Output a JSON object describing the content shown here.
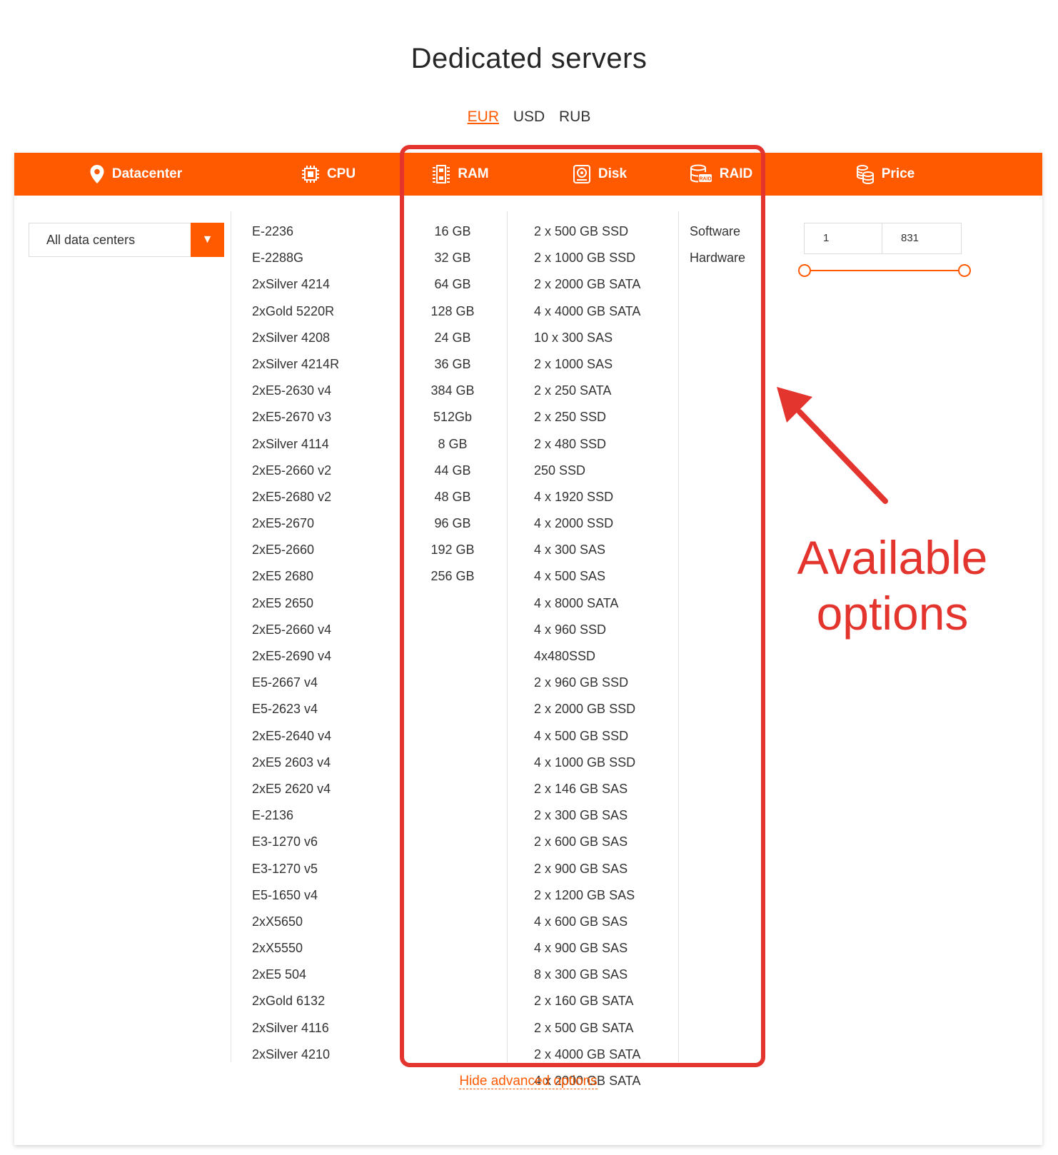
{
  "title": "Dedicated servers",
  "currencies": [
    "EUR",
    "USD",
    "RUB"
  ],
  "active_currency": "EUR",
  "header": {
    "datacenter": "Datacenter",
    "cpu": "CPU",
    "ram": "RAM",
    "disk": "Disk",
    "raid": "RAID",
    "price": "Price"
  },
  "datacenter_select": {
    "value": "All data centers"
  },
  "cpu_options": [
    "E-2236",
    "E-2288G",
    "2xSilver 4214",
    "2xGold 5220R",
    "2xSilver 4208",
    "2xSilver 4214R",
    "2xE5-2630 v4",
    "2xE5-2670 v3",
    "2xSilver 4114",
    "2xE5-2660 v2",
    "2xE5-2680 v2",
    "2xE5-2670",
    "2xE5-2660",
    "2xE5 2680",
    "2xE5 2650",
    "2xE5-2660 v4",
    "2xE5-2690 v4",
    "E5-2667 v4",
    "E5-2623 v4",
    "2xE5-2640 v4",
    "2xE5 2603 v4",
    "2xE5 2620 v4",
    "E-2136",
    "E3-1270 v6",
    "E3-1270 v5",
    "E5-1650 v4",
    "2xX5650",
    "2xX5550",
    "2xE5 504",
    "2xGold 6132",
    "2xSilver 4116",
    "2xSilver 4210"
  ],
  "ram_options": [
    "16 GB",
    "32 GB",
    "64 GB",
    "128 GB",
    "24 GB",
    "36 GB",
    "384 GB",
    "512Gb",
    "8 GB",
    "44 GB",
    "48 GB",
    "96 GB",
    "192 GB",
    "256 GB"
  ],
  "disk_options": [
    "2 x 500 GB SSD",
    "2 x 1000 GB SSD",
    "2 x 2000 GB SATA",
    "4 x 4000 GB SATA",
    "10 x 300 SAS",
    "2 x 1000 SAS",
    "2 x 250 SATA",
    "2 x 250 SSD",
    "2 x 480 SSD",
    "250 SSD",
    "4 x 1920 SSD",
    "4 x 2000 SSD",
    "4 x 300 SAS",
    "4 x 500 SAS",
    "4 x 8000 SATA",
    "4 x 960 SSD",
    "4x480SSD",
    "2 x 960 GB SSD",
    "2 x 2000 GB SSD",
    "4 x 500 GB SSD",
    "4 x 1000 GB SSD",
    "2 x 146 GB SAS",
    "2 x 300 GB SAS",
    "2 x 600 GB SAS",
    "2 x 900 GB SAS",
    "2 x 1200 GB SAS",
    "4 x 600 GB SAS",
    "4 x 900 GB SAS",
    "8 x 300 GB SAS",
    "2 x 160 GB SATA",
    "2 x 500 GB SATA",
    "2 x 4000 GB SATA",
    "4 x 2000 GB SATA"
  ],
  "raid_options": [
    "Software",
    "Hardware"
  ],
  "price": {
    "min": "1",
    "max": "831"
  },
  "hide_link": "Hide advanced options",
  "annotation": {
    "line1": "Available",
    "line2": "options",
    "color": "#e3352e"
  },
  "colors": {
    "accent": "#ff5a00"
  }
}
